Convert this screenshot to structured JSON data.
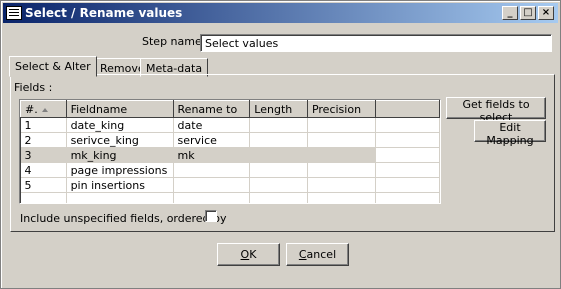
{
  "window": {
    "title": "Select / Rename values"
  },
  "step": {
    "label": "Step name",
    "value": "Select values"
  },
  "tabs": [
    {
      "label": "Select & Alter",
      "active": true
    },
    {
      "label": "Remove",
      "active": false
    },
    {
      "label": "Meta-data",
      "active": false
    }
  ],
  "fields": {
    "label": "Fields :",
    "columns": [
      "#.",
      "Fieldname",
      "Rename to",
      "Length",
      "Precision"
    ],
    "rows": [
      {
        "num": "1",
        "fieldname": "date_king",
        "rename": "date",
        "length": "",
        "precision": ""
      },
      {
        "num": "2",
        "fieldname": "serivce_king",
        "rename": "service",
        "length": "",
        "precision": ""
      },
      {
        "num": "3",
        "fieldname": "mk_king",
        "rename": "mk",
        "length": "",
        "precision": "",
        "selected": true
      },
      {
        "num": "4",
        "fieldname": "page impressions",
        "rename": "",
        "length": "",
        "precision": ""
      },
      {
        "num": "5",
        "fieldname": "pin insertions",
        "rename": "",
        "length": "",
        "precision": ""
      }
    ]
  },
  "buttons": {
    "get_fields": "Get fields to select",
    "edit_mapping": "Edit Mapping",
    "ok_prefix": "",
    "ok_mnemonic": "O",
    "ok_rest": "K",
    "cancel_prefix": "",
    "cancel_mnemonic": "C",
    "cancel_rest": "ancel"
  },
  "include_unspecified": {
    "label": "Include unspecified fields, ordered by",
    "checked": false
  },
  "icons": [
    "app-icon",
    "minimize-icon",
    "maximize-icon",
    "close-icon",
    "sort-ascending-icon",
    "checkbox-icon"
  ]
}
